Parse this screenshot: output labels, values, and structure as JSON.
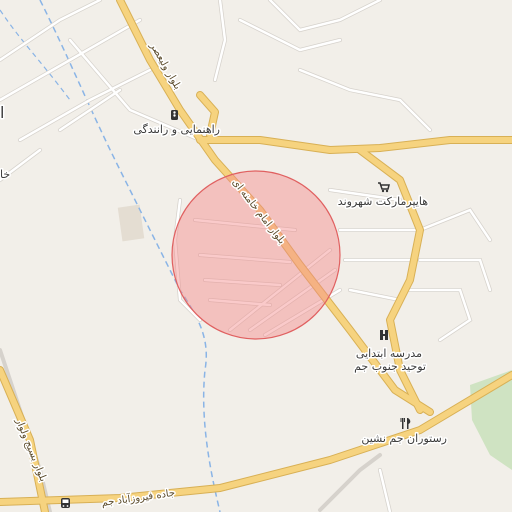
{
  "map": {
    "colors": {
      "land": "#f2efe9",
      "major_road": "#f6d37f",
      "major_road_casing": "#d8b055",
      "minor_road": "#ffffff",
      "minor_road_casing": "#d6d2cc",
      "river": "#8ab4e6",
      "park": "#cfe3c2",
      "search_circle_fill": "#f38a8a",
      "search_circle_stroke": "#e06060"
    },
    "labels": {
      "boulevard_imam": "بلوار امام خامنه ای",
      "boulevard_valiasr": "بلوار ولیعصر",
      "road_firuzabad": "جاده فیروزآباد جم",
      "boulevard_west": "بلوار بسیج ولوار",
      "driving_school": "راهنمایی و رانندگی",
      "hypermarket": "هایپرمارکت شهروند",
      "school_line1": "مدرسه ابتدایی",
      "school_line2": "توحید جنوب جم",
      "restaurant": "رستوران جم نشین",
      "edge_label_1": "خا",
      "edge_label_2": "ا"
    },
    "icons": {
      "driving_school": "traffic-icon",
      "hypermarket": "cart-icon",
      "school": "school-icon",
      "restaurant": "fork-knife-icon",
      "bus": "bus-icon"
    }
  }
}
